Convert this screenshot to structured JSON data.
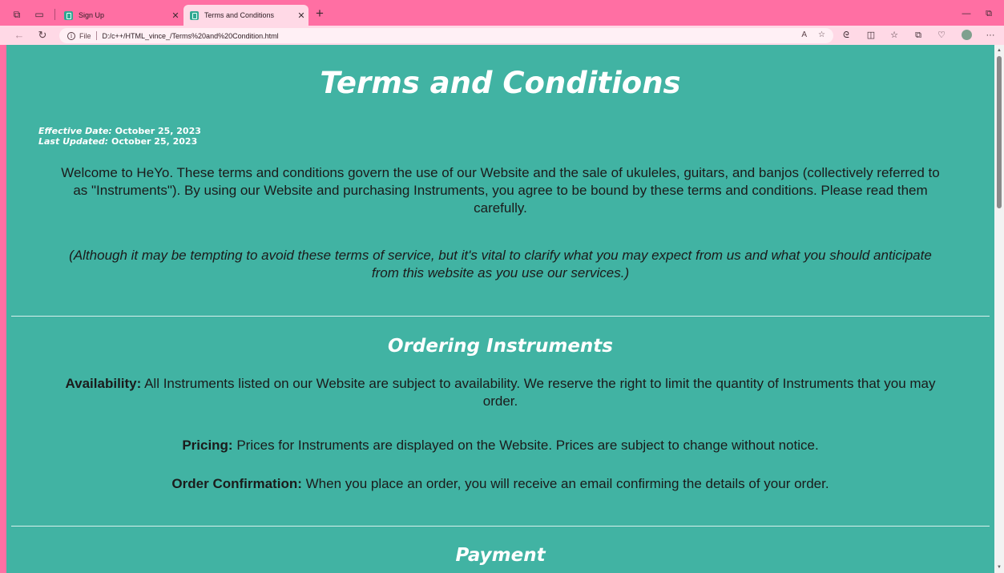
{
  "browser": {
    "tabs": [
      {
        "title": "Sign Up",
        "active": false
      },
      {
        "title": "Terms and Conditions",
        "active": true
      }
    ],
    "new_tab_label": "+",
    "address": {
      "scheme_label": "File",
      "url": "D:/c++/HTML_vince_/Terms%20and%20Condition.html"
    }
  },
  "page": {
    "title": "Terms and Conditions",
    "effective_date_label": "Effective Date:",
    "effective_date": "October 25, 2023",
    "last_updated_label": "Last Updated:",
    "last_updated": "October 25, 2023",
    "intro": "Welcome to HeYo. These terms and conditions govern the use of our Website and the sale of ukuleles, guitars, and banjos (collectively referred to as \"Instruments\"). By using our Website and purchasing Instruments, you agree to be bound by these terms and conditions. Please read them carefully.",
    "aside": "(Although it may be tempting to avoid these terms of service, but it's vital to clarify what you may expect from us and what you should anticipate from this website as you use our services.)",
    "sections": [
      {
        "heading": "Ordering Instruments",
        "clauses": [
          {
            "label": "Availability:",
            "text": "All Instruments listed on our Website are subject to availability. We reserve the right to limit the quantity of Instruments that you may order."
          },
          {
            "label": "Pricing:",
            "text": "Prices for Instruments are displayed on the Website. Prices are subject to change without notice."
          },
          {
            "label": "Order Confirmation:",
            "text": "When you place an order, you will receive an email confirming the details of your order."
          }
        ]
      },
      {
        "heading": "Payment",
        "clauses": []
      }
    ]
  },
  "colors": {
    "browser_chrome": "#ff6fa3",
    "toolbar": "#ffd9e6",
    "page_background": "#41b3a3",
    "heading_text": "#ffffff",
    "body_text": "#1b1b1b"
  },
  "icons": {
    "tab_strip": [
      "workspaces-icon",
      "tab-actions-icon"
    ],
    "navigation": [
      "back-icon",
      "refresh-icon"
    ],
    "address_bar": [
      "site-info-icon",
      "read-aloud-icon",
      "favorite-star-icon"
    ],
    "toolbar": [
      "copilot-icon",
      "split-screen-icon",
      "favorites-icon",
      "collections-icon",
      "extensions-icon",
      "profile-icon",
      "more-icon"
    ],
    "window": [
      "minimize-icon",
      "restore-icon"
    ]
  }
}
